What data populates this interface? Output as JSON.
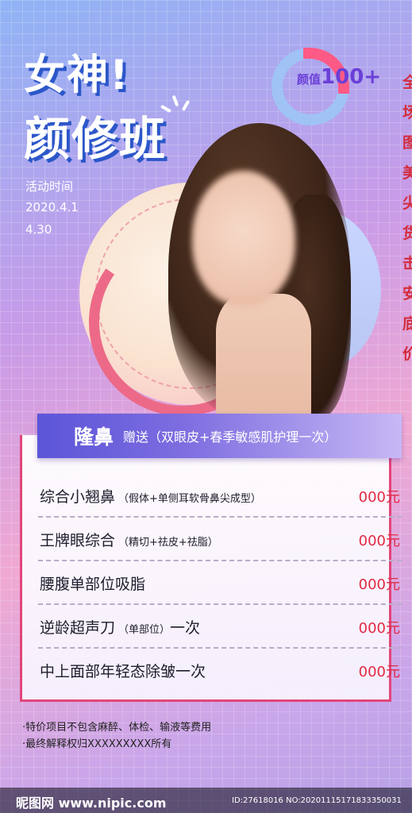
{
  "title": {
    "line1": "女神!",
    "line2": "颜修班"
  },
  "activity": {
    "label": "活动时间",
    "date1": "2020.4.1",
    "date2": "4.30"
  },
  "badge": {
    "prefix": "颜值",
    "value": "100+"
  },
  "side_text": [
    "全",
    "场",
    "图",
    "美",
    "尖",
    "货",
    "击",
    "安",
    "底",
    "价"
  ],
  "banner": {
    "main": "隆鼻",
    "sub": "赠送（双眼皮+春季敏感肌护理一次）"
  },
  "items": [
    {
      "name": "综合小翘鼻",
      "note": "（假体+单侧耳软骨鼻尖成型）",
      "tail": "",
      "price": "000元"
    },
    {
      "name": "王牌眼综合",
      "note": "（精切+祛皮+祛脂）",
      "tail": "",
      "price": "000元"
    },
    {
      "name": "腰腹单部位吸脂",
      "note": "",
      "tail": "",
      "price": "000元"
    },
    {
      "name": "逆龄超声刀",
      "note": "（单部位）",
      "tail": "一次",
      "price": "000元"
    },
    {
      "name": "中上面部年轻态除皱一次",
      "note": "",
      "tail": "",
      "price": "000元"
    }
  ],
  "footnotes": [
    "·特价项目不包含麻醉、体检、输液等费用",
    "·最终解释权归XXXXXXXXX所有"
  ],
  "watermark": {
    "logo": "昵图网 www.nipic.com",
    "id": "ID:27618016 NO:20201115171833350031"
  },
  "colors": {
    "price": "#e22a45",
    "title_shadow": "#2c57c9",
    "banner": "#5b55d8",
    "card_border": "#e2457a"
  }
}
